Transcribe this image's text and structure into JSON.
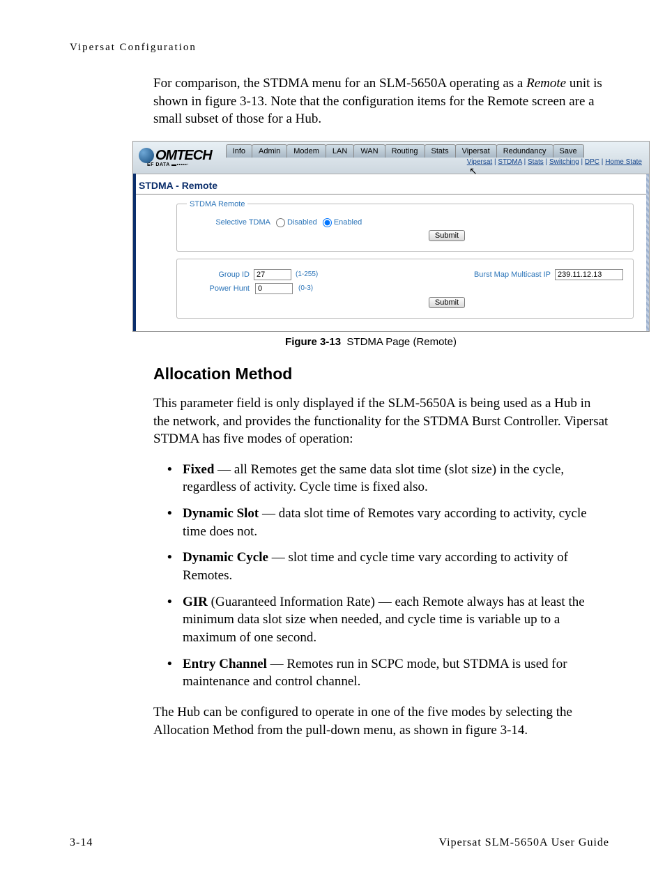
{
  "header": {
    "running_title": "Vipersat Configuration"
  },
  "intro_paragraph": {
    "pre": "For comparison, the STDMA menu for an SLM-5650A operating as a ",
    "remote_word": "Remote",
    "post": " unit is shown in figure 3-13. Note that the configuration items for the Remote screen are a small subset of those for a Hub."
  },
  "screenshot": {
    "logo_text": "OMTECH",
    "logo_sub": "EF DATA ▬▪▪▪▪▪·",
    "tabs": [
      "Info",
      "Admin",
      "Modem",
      "LAN",
      "WAN",
      "Routing",
      "Stats",
      "Vipersat",
      "Redundancy",
      "Save"
    ],
    "sublinks": [
      "Vipersat",
      "STDMA",
      "Stats",
      "Switching",
      "DPC",
      "Home State"
    ],
    "title": "STDMA - Remote",
    "fieldset1": {
      "legend": "STDMA Remote",
      "label": "Selective TDMA",
      "opt_disabled": "Disabled",
      "opt_enabled": "Enabled",
      "submit": "Submit"
    },
    "fieldset2": {
      "group_id_label": "Group ID",
      "group_id_value": "27",
      "group_id_range": "(1-255)",
      "power_hunt_label": "Power Hunt",
      "power_hunt_value": "0",
      "power_hunt_range": "(0-3)",
      "burst_label": "Burst Map Multicast IP",
      "burst_value": "239.11.12.13",
      "submit": "Submit"
    }
  },
  "figure_caption": {
    "label": "Figure 3-13",
    "text": "STDMA Page (Remote)"
  },
  "section_heading": "Allocation Method",
  "alloc_paragraph": "This parameter field is only displayed if the SLM-5650A is being used as a Hub in the network, and provides the functionality for the STDMA Burst Controller. Vipersat STDMA has five modes of operation:",
  "bullets": {
    "b1": {
      "term": "Fixed",
      "rest": " — all Remotes get the same data slot time (slot size) in the cycle, regardless of activity. Cycle time is fixed also."
    },
    "b2": {
      "term": "Dynamic Slot",
      "rest": " — data slot time of Remotes vary according to activity, cycle time does not."
    },
    "b3": {
      "term": "Dynamic Cycle",
      "rest": " — slot time and cycle time vary according to activity of Remotes."
    },
    "b4": {
      "term": "GIR",
      "rest": " (Guaranteed Information Rate) — each Remote always has at least the minimum data slot size when needed, and cycle time is variable up to a maximum of one second."
    },
    "b5": {
      "term": "Entry Channel",
      "rest": " — Remotes run in SCPC mode, but STDMA is used for maintenance and control channel."
    }
  },
  "closing_paragraph": "The Hub can be configured to operate in one of the five modes by selecting the Allocation Method from the pull-down menu, as shown in figure 3-14.",
  "footer": {
    "left": "3-14",
    "right": "Vipersat SLM-5650A User Guide"
  }
}
